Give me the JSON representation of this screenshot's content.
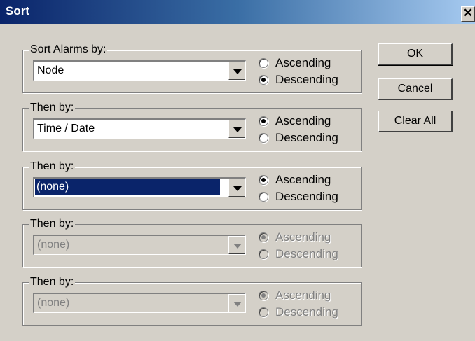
{
  "window": {
    "title": "Sort",
    "close_glyph": "✕"
  },
  "buttons": {
    "ok": "OK",
    "cancel": "Cancel",
    "clear_all": "Clear All"
  },
  "radio_labels": {
    "ascending": "Ascending",
    "descending": "Descending"
  },
  "groups": [
    {
      "label": "Sort Alarms by:",
      "value": "Node",
      "order": "descending",
      "enabled": true,
      "selected": false
    },
    {
      "label": "Then by:",
      "value": "Time / Date",
      "order": "ascending",
      "enabled": true,
      "selected": false
    },
    {
      "label": "Then by:",
      "value": "(none)",
      "order": "ascending",
      "enabled": true,
      "selected": true
    },
    {
      "label": "Then by:",
      "value": "(none)",
      "order": "ascending",
      "enabled": false,
      "selected": false
    },
    {
      "label": "Then by:",
      "value": "(none)",
      "order": "ascending",
      "enabled": false,
      "selected": false
    }
  ]
}
